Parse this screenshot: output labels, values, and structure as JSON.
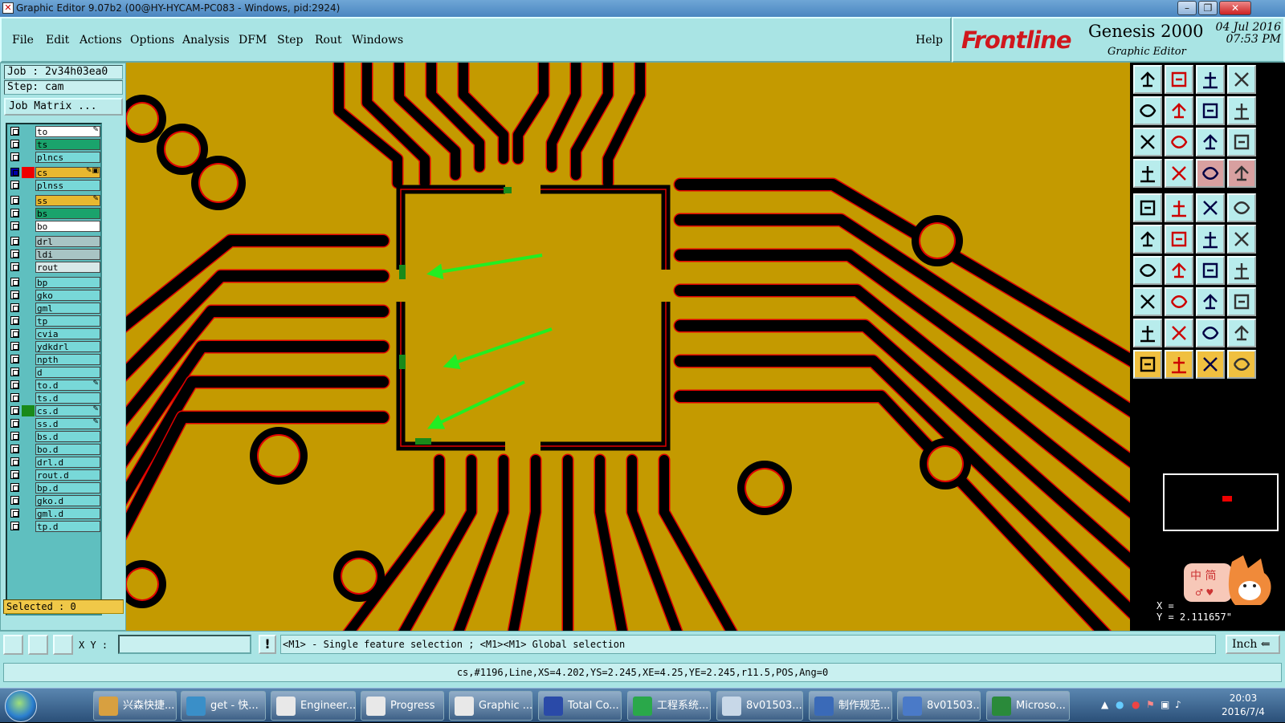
{
  "window": {
    "title": "Graphic Editor 9.07b2 (00@HY-HYCAM-PC083 - Windows, pid:2924)",
    "minimize": "–",
    "maximize": "❐",
    "close": "✕"
  },
  "menu": {
    "items": [
      "File",
      "Edit",
      "Actions",
      "Options",
      "Analysis",
      "DFM",
      "Step",
      "Rout",
      "Windows"
    ],
    "help": "Help"
  },
  "brand": {
    "logo": "Frontline",
    "product": "Genesis 2000",
    "subtitle": "Graphic Editor",
    "date": "04 Jul 2016",
    "time": "07:53 PM"
  },
  "job": {
    "job_line": "Job : 2v34h03ea0",
    "step_line": "Step: cam",
    "job_matrix": "Job Matrix ..."
  },
  "layers": [
    {
      "name": "to",
      "color": "#ffffff",
      "mark": "✎"
    },
    {
      "name": "ts",
      "color": "#1aa36c",
      "mark": ""
    },
    {
      "name": "plncs",
      "color": "#78d8d8",
      "mark": ""
    },
    {
      "name": "cs",
      "color": "#e8b830",
      "mark": "✎▣",
      "active": true
    },
    {
      "name": "plnss",
      "color": "#78d8d8",
      "mark": ""
    },
    {
      "name": "ss",
      "color": "#e8b830",
      "mark": "✎"
    },
    {
      "name": "bs",
      "color": "#1aa36c",
      "mark": ""
    },
    {
      "name": "bo",
      "color": "#ffffff",
      "mark": ""
    },
    {
      "name": "drl",
      "color": "#a8c4c4",
      "mark": ""
    },
    {
      "name": "ldi",
      "color": "#a8c4c4",
      "mark": ""
    },
    {
      "name": "rout",
      "color": "#d8e8e8",
      "mark": ""
    },
    {
      "name": "bp",
      "color": "#78d8d8",
      "mark": ""
    },
    {
      "name": "gko",
      "color": "#78d8d8",
      "mark": ""
    },
    {
      "name": "gml",
      "color": "#78d8d8",
      "mark": ""
    },
    {
      "name": "tp",
      "color": "#78d8d8",
      "mark": ""
    },
    {
      "name": "cvia",
      "color": "#78d8d8",
      "mark": ""
    },
    {
      "name": "ydkdrl",
      "color": "#78d8d8",
      "mark": ""
    },
    {
      "name": "npth",
      "color": "#78d8d8",
      "mark": ""
    },
    {
      "name": "d",
      "color": "#78d8d8",
      "mark": ""
    },
    {
      "name": "to.d",
      "color": "#78d8d8",
      "mark": "✎"
    },
    {
      "name": "ts.d",
      "color": "#78d8d8",
      "mark": ""
    },
    {
      "name": "cs.d",
      "color": "#78d8d8",
      "mark": "✎",
      "swatch": "#1a8a1a"
    },
    {
      "name": "ss.d",
      "color": "#78d8d8",
      "mark": "✎"
    },
    {
      "name": "bs.d",
      "color": "#78d8d8",
      "mark": ""
    },
    {
      "name": "bo.d",
      "color": "#78d8d8",
      "mark": ""
    },
    {
      "name": "drl.d",
      "color": "#78d8d8",
      "mark": ""
    },
    {
      "name": "rout.d",
      "color": "#78d8d8",
      "mark": ""
    },
    {
      "name": "bp.d",
      "color": "#78d8d8",
      "mark": ""
    },
    {
      "name": "gko.d",
      "color": "#78d8d8",
      "mark": ""
    },
    {
      "name": "gml.d",
      "color": "#78d8d8",
      "mark": ""
    },
    {
      "name": "tp.d",
      "color": "#78d8d8",
      "mark": ""
    }
  ],
  "selected": "Selected : 0",
  "canvas": {
    "background": "#c49a00",
    "trace_color": "#000000",
    "outline_color": "#e00000",
    "arrow_color": "#22ee22"
  },
  "toolbox": {
    "buttons": [
      "zoom-home-icon",
      "zoom-in-icon",
      "home-icon",
      "panel-icon",
      "pan-left-icon",
      "pan-right-icon",
      "undo-view-icon",
      "redraw-icon",
      "fit-all-icon",
      "fit-selected-icon",
      "scale-icon",
      "help-icon",
      "settings-icon",
      "grid-icon",
      "layer-colors-icon",
      "layer-colors-2-icon",
      "select-icon",
      "erase-icon",
      "measure-icon",
      "pad-icon",
      "connect-icon",
      "delete-icon",
      "move-point-icon",
      "move-segment-icon",
      "add-line-icon",
      "add-line-2-icon",
      "arc-icon",
      "text-icon",
      "pad-add-icon",
      "cut-icon",
      "stretch-icon",
      "copy-icon",
      "triangle-icon",
      "arc-tool-icon",
      "arc-tool-2-icon",
      "arc-tool-3-icon",
      "pointer-icon",
      "pointer-2-icon",
      "pointer-3-icon",
      "pointer-4-icon"
    ]
  },
  "readout": {
    "x": "X =",
    "y": "Y = 2.111657\""
  },
  "mascot": {
    "text1": "中 简",
    "text2": "♂ ♥"
  },
  "command": {
    "xy_label": "X Y :",
    "xy_value": "",
    "excl": "!",
    "prompt": "<M1> - Single feature selection ; <M1><M1> Global selection",
    "unit": "Inch ⇐"
  },
  "info": "cs,#1196,Line,XS=4.202,YS=2.245,XE=4.25,YE=2.245,r11.5,POS,Ang=0",
  "taskbar": {
    "items": [
      {
        "label": "兴森快捷...",
        "color": "#d8a040"
      },
      {
        "label": "get - 快...",
        "color": "#3a8fc8"
      },
      {
        "label": "Engineer...",
        "color": "#e8e8e8"
      },
      {
        "label": "Progress",
        "color": "#e8e8e8"
      },
      {
        "label": "Graphic ...",
        "color": "#e8e8e8"
      },
      {
        "label": "Total Co...",
        "color": "#2a4aa8"
      },
      {
        "label": "工程系统...",
        "color": "#2aa84a"
      },
      {
        "label": "8v01503...",
        "color": "#c8d8e8"
      },
      {
        "label": "制作规范...",
        "color": "#3a6ab8"
      },
      {
        "label": "8v01503...",
        "color": "#4a7ac8"
      },
      {
        "label": "Microso...",
        "color": "#2a8a3a"
      }
    ],
    "time": "20:03",
    "date": "2016/7/4"
  }
}
